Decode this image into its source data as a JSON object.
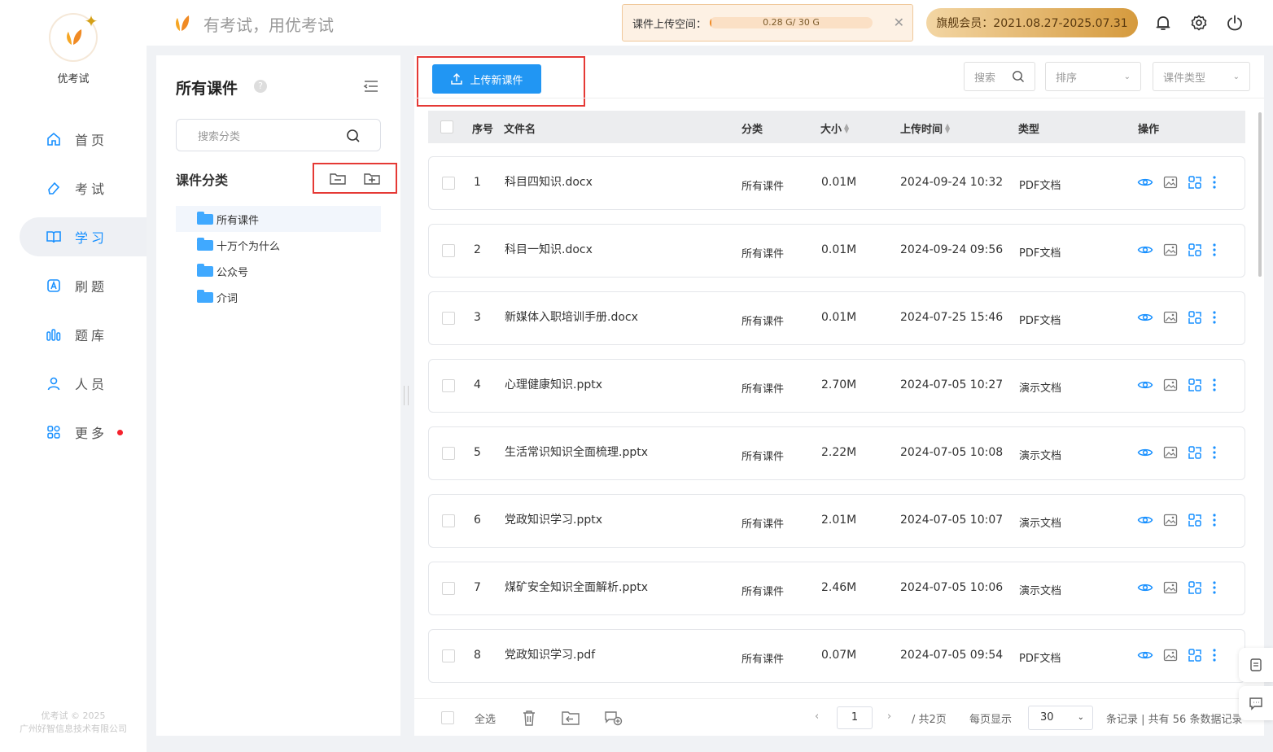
{
  "brand": {
    "name": "优考试",
    "slogan": "有考试，用优考试"
  },
  "nav": [
    {
      "label": "首页",
      "icon": "home-icon"
    },
    {
      "label": "考试",
      "icon": "eraser-icon"
    },
    {
      "label": "学习",
      "icon": "book-icon"
    },
    {
      "label": "刷题",
      "icon": "a-square-icon"
    },
    {
      "label": "题库",
      "icon": "bars-icon"
    },
    {
      "label": "人员",
      "icon": "user-icon"
    },
    {
      "label": "更多",
      "icon": "grid-icon"
    }
  ],
  "active_nav": "学习",
  "copyright": [
    "优考试 © 2025",
    "广州好智信息技术有限公司"
  ],
  "topbar": {
    "space_label": "课件上传空间：",
    "space_text": "0.28 G/ 30 G",
    "space_used_fraction": 0.0093,
    "vip": "旗舰会员：2021.08.27-2025.07.31"
  },
  "category": {
    "title": "所有课件",
    "search_placeholder": "搜索分类",
    "subtitle": "课件分类",
    "items": [
      "所有课件",
      "十万个为什么",
      "公众号",
      "介词"
    ]
  },
  "toolbar": {
    "upload_label": "上传新课件",
    "search_label": "搜索",
    "sort_label": "排序",
    "type_label": "课件类型"
  },
  "table": {
    "headers": {
      "idx": "序号",
      "name": "文件名",
      "cat": "分类",
      "size": "大小",
      "time": "上传时间",
      "type": "类型",
      "ops": "操作"
    },
    "rows": [
      {
        "idx": "1",
        "name": "科目四知识.docx",
        "cat": "所有课件",
        "size": "0.01M",
        "time": "2024-09-24 10:32",
        "type": "PDF文档"
      },
      {
        "idx": "2",
        "name": "科目一知识.docx",
        "cat": "所有课件",
        "size": "0.01M",
        "time": "2024-09-24 09:56",
        "type": "PDF文档"
      },
      {
        "idx": "3",
        "name": "新媒体入职培训手册.docx",
        "cat": "所有课件",
        "size": "0.01M",
        "time": "2024-07-25 15:46",
        "type": "PDF文档"
      },
      {
        "idx": "4",
        "name": "心理健康知识.pptx",
        "cat": "所有课件",
        "size": "2.70M",
        "time": "2024-07-05 10:27",
        "type": "演示文档"
      },
      {
        "idx": "5",
        "name": "生活常识知识全面梳理.pptx",
        "cat": "所有课件",
        "size": "2.22M",
        "time": "2024-07-05 10:08",
        "type": "演示文档"
      },
      {
        "idx": "6",
        "name": "党政知识学习.pptx",
        "cat": "所有课件",
        "size": "2.01M",
        "time": "2024-07-05 10:07",
        "type": "演示文档"
      },
      {
        "idx": "7",
        "name": "煤矿安全知识全面解析.pptx",
        "cat": "所有课件",
        "size": "2.46M",
        "time": "2024-07-05 10:06",
        "type": "演示文档"
      },
      {
        "idx": "8",
        "name": "党政知识学习.pdf",
        "cat": "所有课件",
        "size": "0.07M",
        "time": "2024-07-05 09:54",
        "type": "PDF文档"
      }
    ]
  },
  "footer": {
    "select_all": "全选",
    "page": "1",
    "total_pages": "/ 共2页",
    "per_page_label": "每页显示",
    "per_page": "30",
    "records": "条记录 | 共有 56 条数据记录"
  }
}
